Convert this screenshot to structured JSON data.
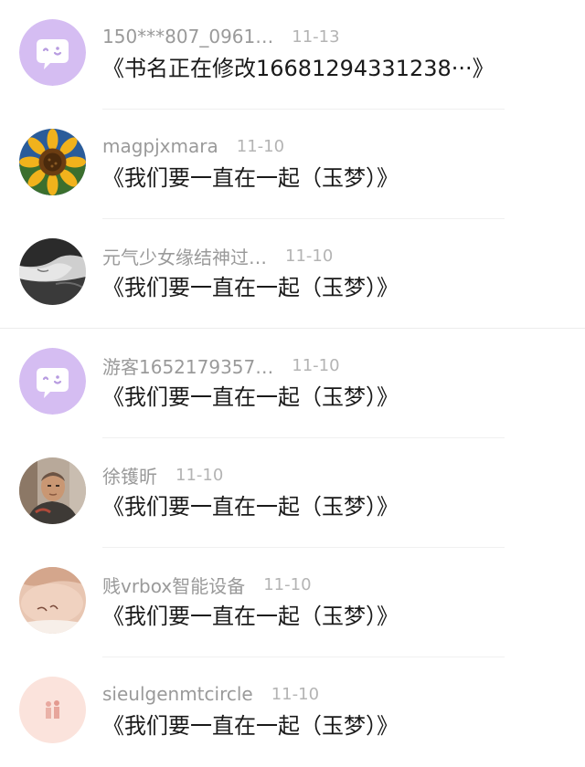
{
  "comments": [
    {
      "avatar": "chat-bubble-avatar-icon",
      "name": "150***807_0961…",
      "date": "11-13",
      "book_title": "《书名正在修改16681294331238···》"
    },
    {
      "avatar": "sunflower-avatar",
      "name": "magpjxmara",
      "date": "11-10",
      "book_title": "《我们要一直在一起（玉梦）》"
    },
    {
      "avatar": "sleeping-person-avatar",
      "name": "元气少女缘结神过…",
      "date": "11-10",
      "book_title": "《我们要一直在一起（玉梦）》"
    },
    {
      "avatar": "chat-bubble-avatar-icon",
      "name": "游客1652179357…",
      "date": "11-10",
      "book_title": "《我们要一直在一起（玉梦）》"
    },
    {
      "avatar": "man-portrait-avatar",
      "name": "徐镬昕",
      "date": "11-10",
      "book_title": "《我们要一直在一起（玉梦）》"
    },
    {
      "avatar": "tattoo-shoulder-avatar",
      "name": "贱vrbox智能设备",
      "date": "11-10",
      "book_title": "《我们要一直在一起（玉梦）》"
    },
    {
      "avatar": "couple-illustration-avatar",
      "name": "sieulgenmtcircle",
      "date": "11-10",
      "book_title": "《我们要一直在一起（玉梦）》"
    }
  ],
  "colors": {
    "default_avatar_bg": "#d5bdf2",
    "name_text": "#9a9a9a",
    "date_text": "#b4b4b4",
    "title_text": "#1a1a1a",
    "divider": "#f0f0f0"
  }
}
